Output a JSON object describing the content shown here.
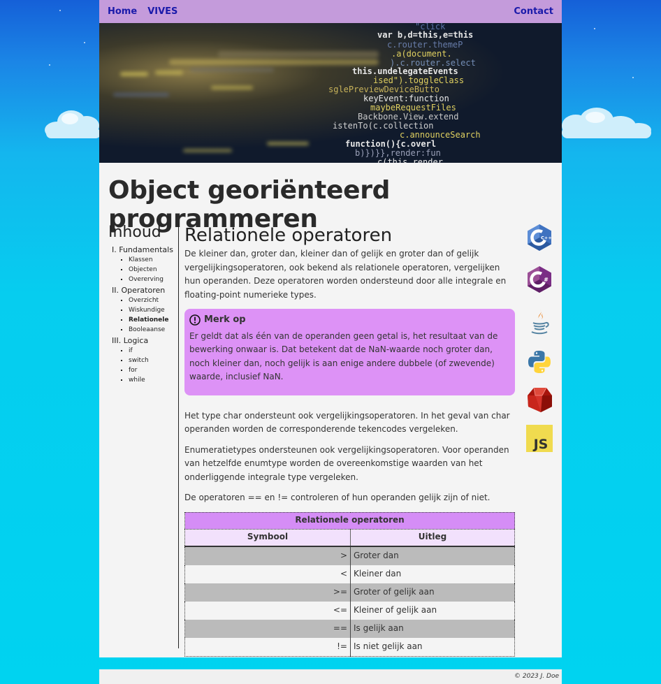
{
  "nav": {
    "home": "Home",
    "vives": "VIVES",
    "contact": "Contact"
  },
  "hero": {
    "lines": [
      "\"click",
      "var b,d=this,e=this",
      "c.router.themeP",
      ".a(document.",
      ").c.router.select",
      "this.undelegateEvents",
      "ised\").toggleClass",
      "sglePreviewDeviceButto",
      "keyEvent:function",
      "maybeRequestFiles",
      "Backbone.View.extend",
      "istenTo(c.collection",
      "c.announceSearch",
      "function(){c.overl",
      "b)})}},render:fun",
      "c(this.render"
    ]
  },
  "page": {
    "title": "Object georiënteerd programmeren"
  },
  "sidebar": {
    "heading": "Inhoud",
    "sections": [
      {
        "label": "I. Fundamentals",
        "items": [
          "Klassen",
          "Objecten",
          "Overerving"
        ]
      },
      {
        "label": "II. Operatoren",
        "items": [
          "Overzicht",
          "Wiskundige",
          "Relationele",
          "Booleaanse"
        ]
      },
      {
        "label": "III. Logica",
        "items": [
          "if",
          "switch",
          "for",
          "while"
        ]
      }
    ]
  },
  "content": {
    "heading": "Relationele operatoren",
    "intro": "De kleiner dan, groter dan, kleiner dan of gelijk en groter dan of gelijk vergelijkingsoperatoren, ook bekend als relationele operatoren, vergelijken hun operanden. Deze operatoren worden ondersteund door alle integrale en floating-point numerieke types.",
    "note": {
      "title": "Merk op",
      "body": "Er geldt dat als één van de operanden geen getal is, het resultaat van de bewerking onwaar is. Dat betekent dat de NaN-waarde noch groter dan, noch kleiner dan, noch gelijk is aan enige andere dubbele (of zwevende) waarde, inclusief NaN."
    },
    "p1": "Het type char ondersteunt ook vergelijkingsoperatoren. In het geval van char operanden worden de corresponderende tekencodes vergeleken.",
    "p2": "Enumeratietypes ondersteunen ook vergelijkingsoperatoren. Voor operanden van hetzelfde enumtype worden de overeenkomstige waarden van het onderliggende integrale type vergeleken.",
    "p3": "De operatoren == en != controleren of hun operanden gelijk zijn of niet."
  },
  "table": {
    "caption": "Relationele operatoren",
    "headers": [
      "Symbool",
      "Uitleg"
    ],
    "rows": [
      [
        ">",
        "Groter dan"
      ],
      [
        "<",
        "Kleiner dan"
      ],
      [
        ">=",
        "Groter of gelijk aan"
      ],
      [
        "<=",
        "Kleiner of gelijk aan"
      ],
      [
        "==",
        "Is gelijk aan"
      ],
      [
        "!=",
        "Is niet gelijk aan"
      ]
    ]
  },
  "languages": [
    {
      "name": "cpp-icon",
      "label": "C++"
    },
    {
      "name": "csharp-icon",
      "label": "#"
    },
    {
      "name": "java-icon"
    },
    {
      "name": "python-icon"
    },
    {
      "name": "ruby-icon"
    },
    {
      "name": "javascript-icon",
      "label": "JS"
    }
  ],
  "footer": {
    "text": "© 2023 J. Doe"
  },
  "colors": {
    "nav": "#c49bdb",
    "note": "#dd92f6",
    "tableCaption": "#d58df6",
    "link": "#1a1aaa",
    "sky": "#00d3f0"
  }
}
